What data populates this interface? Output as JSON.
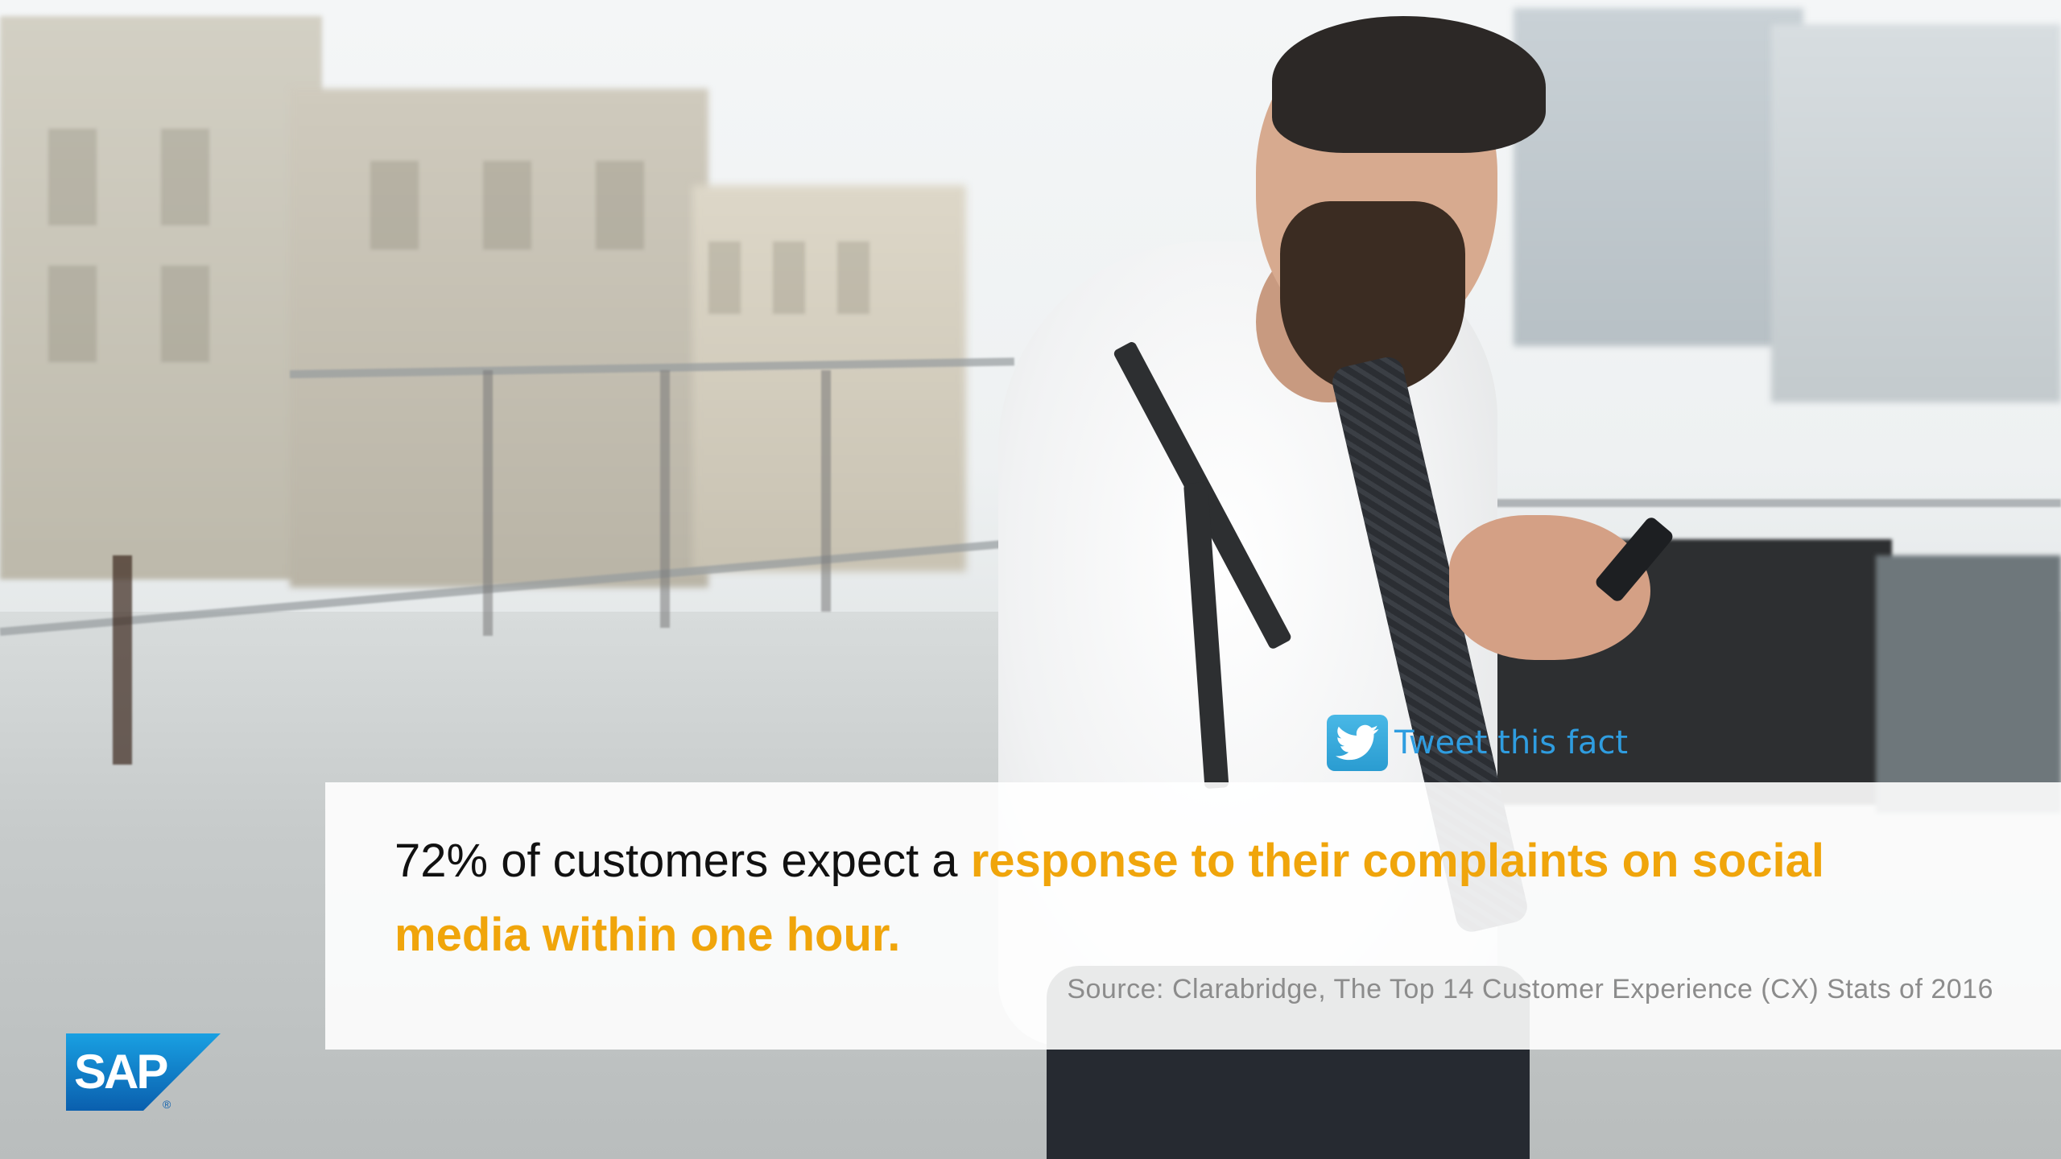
{
  "tweet": {
    "label": "Tweet this fact",
    "icon": "twitter-bird-icon",
    "color": "#2f9de0"
  },
  "quote": {
    "prefix": "72% of customers expect a ",
    "highlight": "response to their complaints on social media within one hour.",
    "highlight_color": "#f0a50b",
    "source": "Source: Clarabridge, The Top 14 Customer Experience (CX) Stats of 2016"
  },
  "brand": {
    "logo_text": "SAP",
    "registered_mark": "®",
    "color": "#1479c9"
  }
}
